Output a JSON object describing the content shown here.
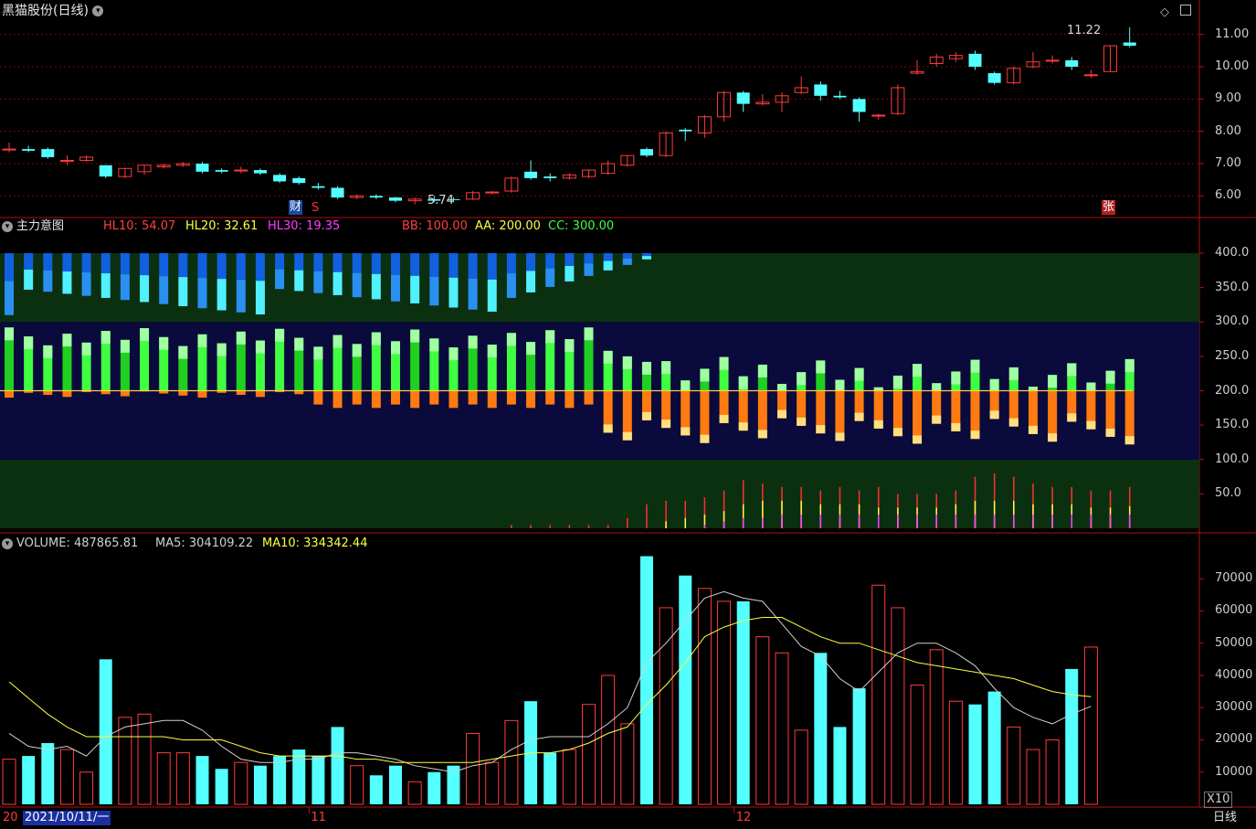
{
  "header": {
    "title": "黑猫股份(日线)"
  },
  "price_panel": {
    "high_label": "11.22",
    "low_label": "5.74",
    "marks": {
      "cai": "财",
      "s": "S",
      "zhang": "张"
    }
  },
  "indicator_panel": {
    "name": "主力意图",
    "items": [
      {
        "label": "HL10: 54.07",
        "color": "#ff4040"
      },
      {
        "label": "HL20: 32.61",
        "color": "#ffff40"
      },
      {
        "label": "HL30: 19.35",
        "color": "#ff40ff"
      },
      {
        "label": "BB: 100.00",
        "color": "#ff4040"
      },
      {
        "label": "AA: 200.00",
        "color": "#ffff40"
      },
      {
        "label": "CC: 300.00",
        "color": "#40ff40"
      }
    ]
  },
  "volume_panel": {
    "items": [
      {
        "label": "VOLUME: 487865.81",
        "color": "#d0d0d0"
      },
      {
        "label": "MA5: 304109.22",
        "color": "#d0d0d0"
      },
      {
        "label": "MA10: 334342.44",
        "color": "#ffff40"
      }
    ],
    "unit": "X10"
  },
  "footer": {
    "date_cursor": "2021/10/11/一",
    "year_prefix": "20",
    "period": "日线"
  },
  "chart_data": [
    {
      "type": "candlestick",
      "title": "黑猫股份(日线)",
      "ylim": [
        5.5,
        11.5
      ],
      "y_ticks": [
        "6.00",
        "7.00",
        "8.00",
        "9.00",
        "10.00",
        "11.00"
      ],
      "x_ticks": [
        {
          "index": 16,
          "label": "11"
        },
        {
          "index": 38,
          "label": "12"
        }
      ],
      "up_color": "#ff3b3b",
      "down_color": "#54ffff",
      "candles": [
        {
          "o": 7.45,
          "h": 7.65,
          "c": 7.45,
          "l": 7.35
        },
        {
          "o": 7.45,
          "h": 7.55,
          "c": 7.4,
          "l": 7.35
        },
        {
          "o": 7.45,
          "h": 7.5,
          "c": 7.2,
          "l": 7.15
        },
        {
          "o": 7.1,
          "h": 7.25,
          "c": 7.1,
          "l": 6.95
        },
        {
          "o": 7.1,
          "h": 7.25,
          "c": 7.2,
          "l": 7.05
        },
        {
          "o": 6.95,
          "h": 6.95,
          "c": 6.6,
          "l": 6.55
        },
        {
          "o": 6.6,
          "h": 6.85,
          "c": 6.85,
          "l": 6.55
        },
        {
          "o": 6.75,
          "h": 6.95,
          "c": 6.95,
          "l": 6.65
        },
        {
          "o": 6.9,
          "h": 7.0,
          "c": 6.95,
          "l": 6.85
        },
        {
          "o": 6.95,
          "h": 7.05,
          "c": 7.0,
          "l": 6.9
        },
        {
          "o": 7.0,
          "h": 7.05,
          "c": 6.75,
          "l": 6.7
        },
        {
          "o": 6.8,
          "h": 6.85,
          "c": 6.75,
          "l": 6.7
        },
        {
          "o": 6.8,
          "h": 6.9,
          "c": 6.8,
          "l": 6.7
        },
        {
          "o": 6.8,
          "h": 6.85,
          "c": 6.7,
          "l": 6.65
        },
        {
          "o": 6.65,
          "h": 6.7,
          "c": 6.45,
          "l": 6.4
        },
        {
          "o": 6.55,
          "h": 6.6,
          "c": 6.4,
          "l": 6.35
        },
        {
          "o": 6.3,
          "h": 6.4,
          "c": 6.25,
          "l": 6.2
        },
        {
          "o": 6.25,
          "h": 6.3,
          "c": 5.95,
          "l": 5.9
        },
        {
          "o": 5.95,
          "h": 6.05,
          "c": 6.0,
          "l": 5.9
        },
        {
          "o": 6.0,
          "h": 6.05,
          "c": 5.95,
          "l": 5.9
        },
        {
          "o": 5.95,
          "h": 5.97,
          "c": 5.85,
          "l": 5.8
        },
        {
          "o": 5.85,
          "h": 5.95,
          "c": 5.9,
          "l": 5.74
        },
        {
          "o": 5.9,
          "h": 6.0,
          "c": 5.85,
          "l": 5.8
        },
        {
          "o": 5.9,
          "h": 5.95,
          "c": 5.88,
          "l": 5.8
        },
        {
          "o": 5.9,
          "h": 6.15,
          "c": 6.1,
          "l": 5.88
        },
        {
          "o": 6.1,
          "h": 6.15,
          "c": 6.12,
          "l": 6.05
        },
        {
          "o": 6.15,
          "h": 6.6,
          "c": 6.55,
          "l": 6.1
        },
        {
          "o": 6.75,
          "h": 7.1,
          "c": 6.55,
          "l": 6.5
        },
        {
          "o": 6.6,
          "h": 6.7,
          "c": 6.55,
          "l": 6.45
        },
        {
          "o": 6.55,
          "h": 6.7,
          "c": 6.65,
          "l": 6.5
        },
        {
          "o": 6.6,
          "h": 6.8,
          "c": 6.8,
          "l": 6.55
        },
        {
          "o": 6.7,
          "h": 7.1,
          "c": 7.0,
          "l": 6.65
        },
        {
          "o": 6.95,
          "h": 7.25,
          "c": 7.25,
          "l": 6.9
        },
        {
          "o": 7.45,
          "h": 7.5,
          "c": 7.25,
          "l": 7.2
        },
        {
          "o": 7.25,
          "h": 8.0,
          "c": 7.95,
          "l": 7.2
        },
        {
          "o": 8.05,
          "h": 8.1,
          "c": 8.0,
          "l": 7.7
        },
        {
          "o": 7.95,
          "h": 8.5,
          "c": 8.45,
          "l": 7.8
        },
        {
          "o": 8.45,
          "h": 9.25,
          "c": 9.2,
          "l": 8.3
        },
        {
          "o": 9.2,
          "h": 9.25,
          "c": 8.85,
          "l": 8.6
        },
        {
          "o": 8.85,
          "h": 9.15,
          "c": 8.9,
          "l": 8.8
        },
        {
          "o": 8.9,
          "h": 9.2,
          "c": 9.1,
          "l": 8.6
        },
        {
          "o": 9.2,
          "h": 9.7,
          "c": 9.35,
          "l": 9.15
        },
        {
          "o": 9.45,
          "h": 9.55,
          "c": 9.1,
          "l": 8.95
        },
        {
          "o": 9.1,
          "h": 9.25,
          "c": 9.05,
          "l": 9.0
        },
        {
          "o": 9.0,
          "h": 9.05,
          "c": 8.6,
          "l": 8.3
        },
        {
          "o": 8.5,
          "h": 8.55,
          "c": 8.5,
          "l": 8.35
        },
        {
          "o": 8.55,
          "h": 9.45,
          "c": 9.35,
          "l": 8.5
        },
        {
          "o": 9.8,
          "h": 10.2,
          "c": 9.85,
          "l": 9.75
        },
        {
          "o": 10.1,
          "h": 10.4,
          "c": 10.3,
          "l": 10.0
        },
        {
          "o": 10.25,
          "h": 10.45,
          "c": 10.35,
          "l": 10.15
        },
        {
          "o": 10.4,
          "h": 10.5,
          "c": 10.0,
          "l": 9.9
        },
        {
          "o": 9.8,
          "h": 9.85,
          "c": 9.5,
          "l": 9.45
        },
        {
          "o": 9.5,
          "h": 10.0,
          "c": 9.95,
          "l": 9.45
        },
        {
          "o": 10.0,
          "h": 10.45,
          "c": 10.15,
          "l": 9.95
        },
        {
          "o": 10.2,
          "h": 10.35,
          "c": 10.2,
          "l": 10.1
        },
        {
          "o": 10.2,
          "h": 10.3,
          "c": 10.0,
          "l": 9.9
        },
        {
          "o": 9.75,
          "h": 9.9,
          "c": 9.75,
          "l": 9.65
        },
        {
          "o": 9.85,
          "h": 10.65,
          "c": 10.65,
          "l": 9.85
        },
        {
          "o": 10.75,
          "h": 11.22,
          "c": 10.65,
          "l": 10.6
        }
      ]
    },
    {
      "type": "bar",
      "title": "主力意图",
      "ylim": [
        0,
        420
      ],
      "y_ticks": [
        "50.0",
        "100.0",
        "150.0",
        "200.0",
        "250.0",
        "300.0",
        "350.0",
        "400.0"
      ],
      "zones": [
        {
          "from": 0,
          "to": 100,
          "color": "#0b3010"
        },
        {
          "from": 100,
          "to": 300,
          "color": "#0a0a3d"
        },
        {
          "from": 300,
          "to": 400,
          "color": "#0b3010"
        }
      ],
      "baseline": 200,
      "series": [
        {
          "name": "HL10",
          "color": "#ff4040",
          "values": [
            0,
            0,
            0,
            0,
            0,
            0,
            0,
            0,
            0,
            0,
            0,
            0,
            0,
            0,
            0,
            0,
            0,
            0,
            0,
            0,
            0,
            0,
            0,
            0,
            0,
            0,
            5,
            5,
            5,
            5,
            5,
            5,
            15,
            35,
            40,
            40,
            45,
            55,
            70,
            65,
            60,
            60,
            55,
            60,
            55,
            60,
            50,
            50,
            50,
            55,
            75,
            80,
            75,
            65,
            60,
            60,
            55,
            55,
            60,
            55
          ]
        },
        {
          "name": "HL20",
          "color": "#ffff40",
          "values": [
            0,
            0,
            0,
            0,
            0,
            0,
            0,
            0,
            0,
            0,
            0,
            0,
            0,
            0,
            0,
            0,
            0,
            0,
            0,
            0,
            0,
            0,
            0,
            0,
            0,
            0,
            0,
            0,
            0,
            0,
            0,
            0,
            0,
            0,
            10,
            15,
            20,
            25,
            35,
            40,
            40,
            40,
            35,
            35,
            35,
            30,
            30,
            30,
            30,
            35,
            40,
            40,
            40,
            35,
            35,
            35,
            30,
            30,
            32,
            33
          ]
        },
        {
          "name": "HL30",
          "color": "#ff40ff",
          "values": [
            0,
            0,
            0,
            0,
            0,
            0,
            0,
            0,
            0,
            0,
            0,
            0,
            0,
            0,
            0,
            0,
            0,
            0,
            0,
            0,
            0,
            0,
            0,
            0,
            0,
            0,
            0,
            0,
            0,
            0,
            0,
            0,
            0,
            0,
            0,
            0,
            5,
            10,
            15,
            15,
            20,
            20,
            20,
            20,
            20,
            20,
            20,
            20,
            20,
            20,
            20,
            20,
            20,
            20,
            20,
            20,
            20,
            20,
            20,
            19
          ]
        },
        {
          "name": "AA",
          "color": "#ffff40",
          "values": [
            200,
            200,
            200,
            200,
            200,
            200,
            200,
            200,
            200,
            200,
            200,
            200,
            200,
            200,
            200,
            200,
            200,
            200,
            200,
            200,
            200,
            200,
            200,
            200,
            200,
            200,
            200,
            200,
            200,
            200,
            200,
            200,
            200,
            200,
            200,
            200,
            200,
            200,
            200,
            200,
            200,
            200,
            200,
            200,
            200,
            200,
            200,
            200,
            200,
            200,
            200,
            200,
            200,
            200,
            200,
            200,
            200,
            200,
            200,
            200
          ]
        }
      ]
    },
    {
      "type": "bar",
      "title": "VOLUME",
      "ylim": [
        0,
        78000
      ],
      "y_ticks": [
        "10000",
        "20000",
        "30000",
        "40000",
        "50000",
        "60000",
        "70000"
      ],
      "series": [
        {
          "name": "VOLUME",
          "values": [
            14000,
            15000,
            19000,
            17000,
            10000,
            45000,
            27000,
            28000,
            16000,
            16000,
            15000,
            11000,
            13000,
            12000,
            15000,
            17000,
            15000,
            24000,
            12000,
            9000,
            12000,
            7000,
            10000,
            12000,
            22000,
            13000,
            26000,
            32000,
            16000,
            17000,
            31000,
            40000,
            25000,
            77000,
            61000,
            71000,
            67000,
            63000,
            63000,
            52000,
            47000,
            23000,
            47000,
            24000,
            36000,
            68000,
            61000,
            37000,
            48000,
            32000,
            31000,
            35000,
            24000,
            17000,
            20000,
            42000,
            48800
          ]
        },
        {
          "name": "MA5",
          "color": "#d0d0d0",
          "values": [
            22000,
            18000,
            17000,
            18000,
            15000,
            21000,
            24000,
            25000,
            26000,
            26000,
            23000,
            18000,
            14000,
            13000,
            13000,
            14000,
            14000,
            16000,
            16000,
            15000,
            14000,
            12000,
            11000,
            10000,
            12000,
            13000,
            17000,
            20000,
            21000,
            21000,
            21000,
            25000,
            30000,
            44000,
            50000,
            57000,
            64000,
            66000,
            64000,
            63000,
            56000,
            49000,
            46000,
            39000,
            35000,
            41000,
            47000,
            50000,
            50000,
            47000,
            43000,
            36000,
            30000,
            27000,
            25000,
            28000,
            30400
          ]
        },
        {
          "name": "MA10",
          "color": "#ffff40",
          "values": [
            38000,
            33000,
            28000,
            24000,
            21000,
            21000,
            21000,
            21000,
            21000,
            20000,
            20000,
            20000,
            18000,
            16000,
            15000,
            15000,
            15000,
            15000,
            14000,
            14000,
            13000,
            13000,
            13000,
            13000,
            13000,
            14000,
            15000,
            16000,
            16000,
            17000,
            19000,
            22000,
            24000,
            31000,
            37000,
            44000,
            52000,
            55000,
            57000,
            58000,
            58000,
            55000,
            52000,
            50000,
            50000,
            48000,
            46000,
            44000,
            43000,
            42000,
            41000,
            40000,
            39000,
            37000,
            35000,
            34000,
            33400
          ]
        }
      ]
    }
  ]
}
